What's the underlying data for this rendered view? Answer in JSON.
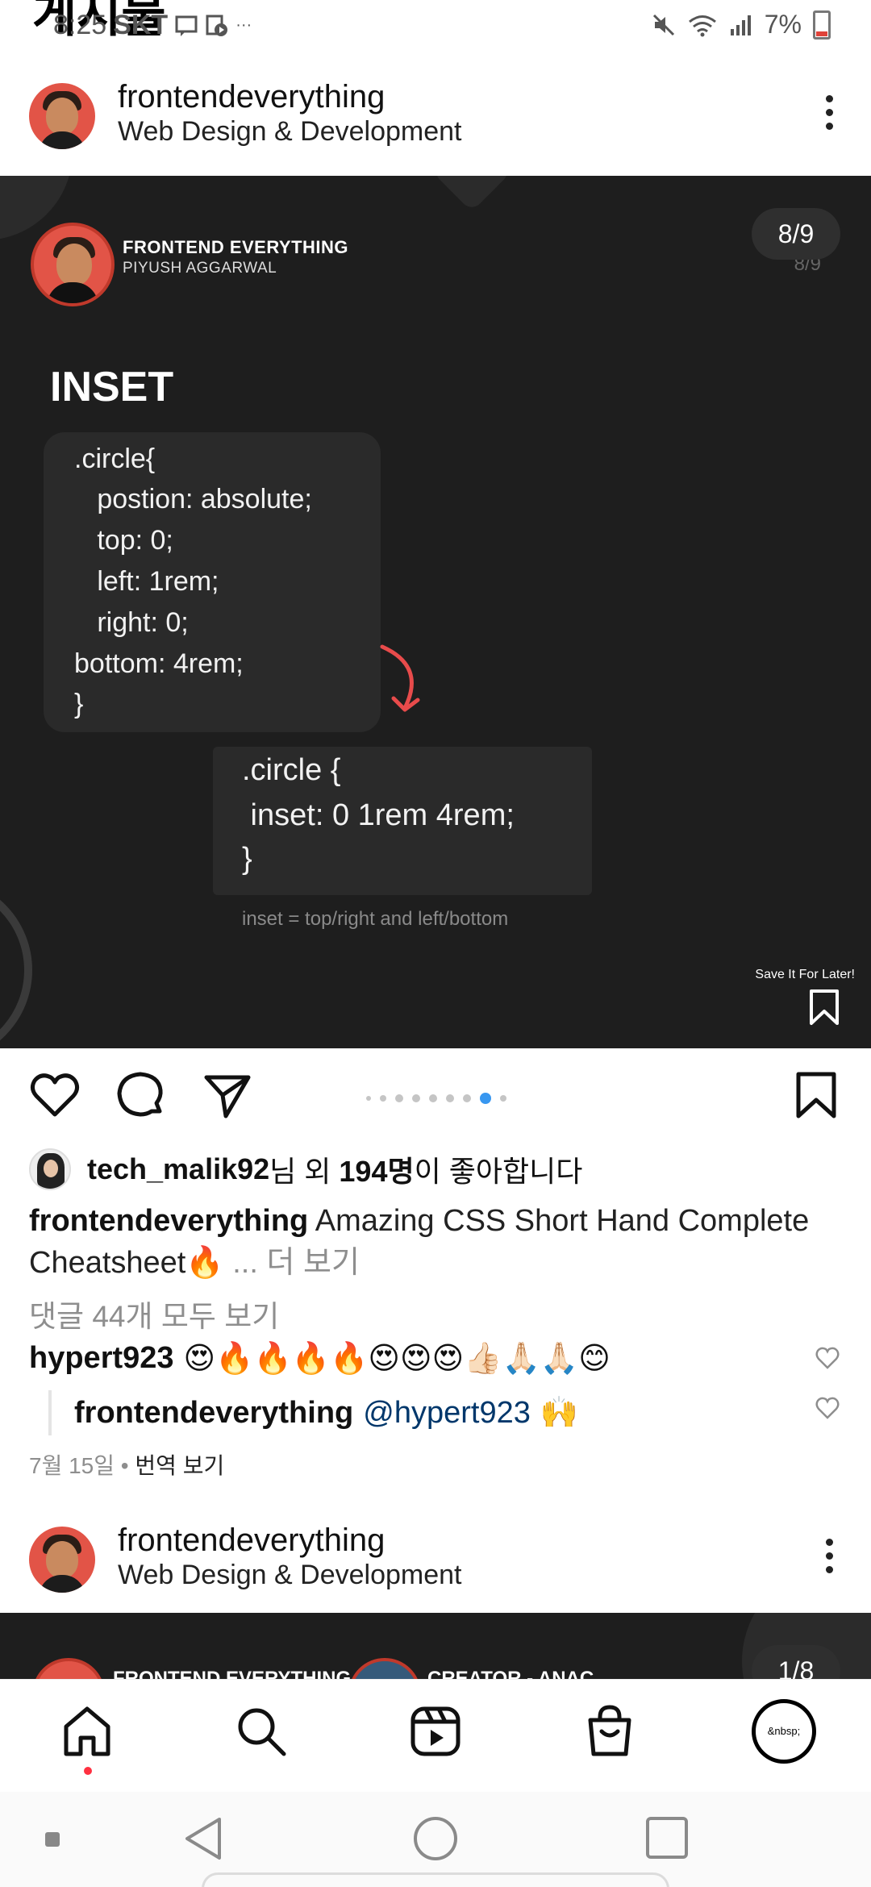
{
  "status_bar": {
    "overlay_title": "게시물",
    "time": "8:25",
    "carrier": "SKT",
    "battery": "7%"
  },
  "post": {
    "username": "frontendeverything",
    "subtitle": "Web Design & Development",
    "slide": {
      "brand_name": "FRONTEND EVERYTHING",
      "brand_author": "PIYUSH AGGARWAL",
      "counter": "8/9",
      "counter_ghost": "8/9",
      "heading": "INSET",
      "code_long": [
        ".circle{",
        "   postion: absolute;",
        "   top: 0;",
        "   left: 1rem;",
        "   right: 0;",
        "bottom: 4rem;",
        "}"
      ],
      "code_short": [
        ".circle {",
        " inset: 0 1rem 4rem;",
        "}"
      ],
      "caption": "inset = top/right and left/bottom",
      "save_later": "Save It For Later!",
      "total_dots": 9,
      "active_dot": 8
    },
    "likes": {
      "liker": "tech_malik92",
      "suffix_1": "님 외 ",
      "count": "194명",
      "suffix_2": "이 좋아합니다"
    },
    "caption": {
      "username": "frontendeverything",
      "text": "Amazing CSS Short Hand Complete Cheatsheet🔥",
      "more": "... 더 보기"
    },
    "view_comments": "댓글 44개 모두 보기",
    "comments": [
      {
        "user": "hypert923",
        "text": "😍🔥🔥🔥🔥😍😍😍👍🏻🙏🏻🙏🏻😊"
      },
      {
        "user": "frontendeverything",
        "mention": "@hypert923",
        "text": "🙌"
      }
    ],
    "meta": {
      "date": "7월 15일",
      "separator": " • ",
      "translate": "번역 보기"
    }
  },
  "post2": {
    "username": "frontendeverything",
    "subtitle": "Web Design & Development",
    "brand_partial": "FRONTEND EVERYTHING",
    "creator_partial": "CREATOR - ANAC",
    "counter": "1/8"
  },
  "bottom_nav": {
    "profile_text": "&nbsp;",
    "items": [
      "home",
      "search",
      "reels",
      "shop",
      "profile"
    ]
  },
  "colors": {
    "accent_blue": "#3897f0",
    "notification_red": "#ff3040",
    "slide_bg": "#1e1e1e",
    "mention": "#00376b"
  }
}
